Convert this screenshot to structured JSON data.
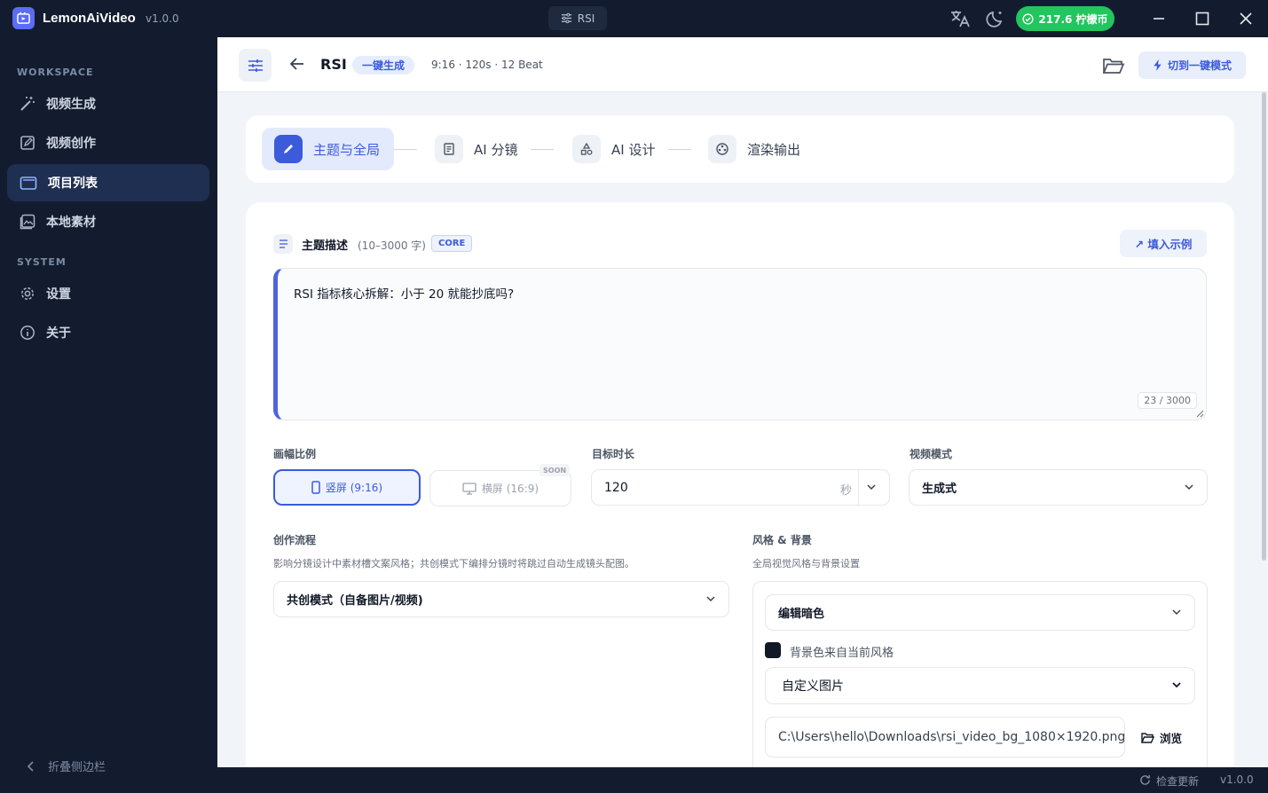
{
  "app": {
    "brand": "LemonAiVideo",
    "version": "v1.0.0",
    "window_tab": "RSI",
    "coins": "217.6 柠檬币"
  },
  "sidebar": {
    "workspace_label": "WORKSPACE",
    "system_label": "SYSTEM",
    "items": [
      {
        "label": "视频生成",
        "icon": "magic-wand-icon"
      },
      {
        "label": "视频创作",
        "icon": "edit-square-icon"
      },
      {
        "label": "项目列表",
        "icon": "folder-icon"
      },
      {
        "label": "本地素材",
        "icon": "image-library-icon"
      },
      {
        "label": "设置",
        "icon": "gear-icon"
      },
      {
        "label": "关于",
        "icon": "info-icon"
      }
    ],
    "active_index": 2,
    "collapse_label": "折叠侧边栏"
  },
  "topbar": {
    "project_name": "RSI",
    "mode_pill": "一键生成",
    "meta": "9:16 · 120s · 12 Beat",
    "switch_label": "切到一键模式"
  },
  "steps": [
    {
      "label": "主题与全局",
      "icon": "pencil-icon",
      "active": true
    },
    {
      "label": "AI 分镜",
      "icon": "storyboard-icon",
      "active": false
    },
    {
      "label": "AI 设计",
      "icon": "shapes-icon",
      "active": false
    },
    {
      "label": "渲染输出",
      "icon": "film-reel-icon",
      "active": false
    }
  ],
  "topic": {
    "title": "主题描述",
    "hint": "(10–3000 字)",
    "badge": "CORE",
    "example_btn": "↗ 填入示例",
    "value": "RSI 指标核心拆解：小于 20 就能抄底吗?",
    "counter": "23 / 3000"
  },
  "ratio": {
    "label": "画幅比例",
    "portrait": "竖屏 (9:16)",
    "landscape": "横屏 (16:9)",
    "soon": "SOON"
  },
  "duration": {
    "label": "目标时长",
    "value": "120",
    "unit": "秒"
  },
  "video_mode": {
    "label": "视频模式",
    "value": "生成式"
  },
  "workflow": {
    "label": "创作流程",
    "desc": "影响分镜设计中素材槽文案风格；共创模式下编排分镜时将跳过自动生成镜头配图。",
    "value": "共创模式（自备图片/视频)"
  },
  "style": {
    "label": "风格 & 背景",
    "desc": "全局视觉风格与背景设置",
    "theme": "编辑暗色",
    "bg_checkbox": "背景色来自当前风格",
    "bg_mode": "自定义图片",
    "path": "C:\\Users\\hello\\Downloads\\rsi_video_bg_1080×1920.png",
    "browse": "浏览"
  },
  "statusbar": {
    "update": "检查更新",
    "version": "v1.0.0"
  },
  "colors": {
    "accent": "#3b5bdb",
    "sidebar_bg": "#131c2e",
    "coin_green": "#22c55e"
  }
}
